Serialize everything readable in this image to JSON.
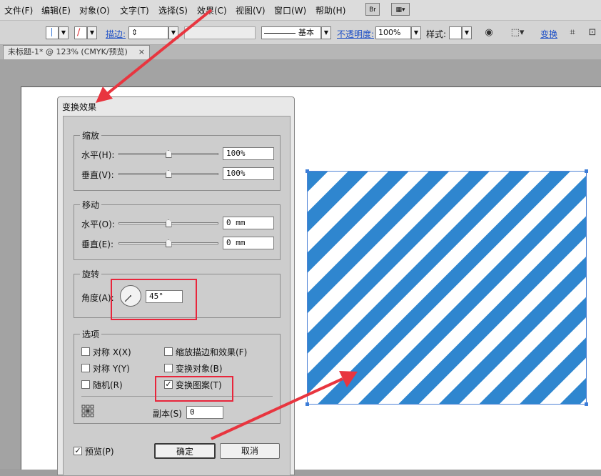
{
  "menubar": {
    "items": [
      "文件(F)",
      "编辑(E)",
      "对象(O)",
      "文字(T)",
      "选择(S)",
      "效果(C)",
      "视图(V)",
      "窗口(W)",
      "帮助(H)"
    ],
    "br_label": "Br"
  },
  "toolbar": {
    "stroke_label": "描边:",
    "brush_label": "基本",
    "opacity_label": "不透明度:",
    "opacity_value": "100%",
    "style_label": "样式:",
    "transform_label": "变换"
  },
  "document_tab": {
    "title": "未标题-1* @ 123% (CMYK/预览)",
    "close": "×"
  },
  "dialog": {
    "title": "变换效果",
    "scale": {
      "legend": "缩放",
      "h_label": "水平(H):",
      "h_value": "100%",
      "h_level_percent": 50,
      "v_label": "垂直(V):",
      "v_value": "100%",
      "v_level_percent": 50
    },
    "move": {
      "legend": "移动",
      "h_label": "水平(O):",
      "h_value": "0 mm",
      "h_level_percent": 50,
      "v_label": "垂直(E):",
      "v_value": "0 mm",
      "v_level_percent": 50
    },
    "rotate": {
      "legend": "旋转",
      "angle_label": "角度(A):",
      "angle_value": "45°",
      "angle_degrees": 45
    },
    "options": {
      "legend": "选项",
      "reflect_x": "对称 X(X)",
      "reflect_y": "对称 Y(Y)",
      "random": "随机(R)",
      "scale_strokes": "缩放描边和效果(F)",
      "transform_objects": "变换对象(B)",
      "transform_patterns": "变换图案(T)",
      "transform_patterns_checked": true,
      "copies_label": "副本(S)",
      "copies_value": "0"
    },
    "preview_label": "预览(P)",
    "preview_checked": true,
    "ok_label": "确定",
    "cancel_label": "取消",
    "check_mark": "✓"
  },
  "colors": {
    "stripe_blue": "#2f86cf",
    "highlight_red": "#e8253b",
    "arrow_red": "#e8353f"
  }
}
